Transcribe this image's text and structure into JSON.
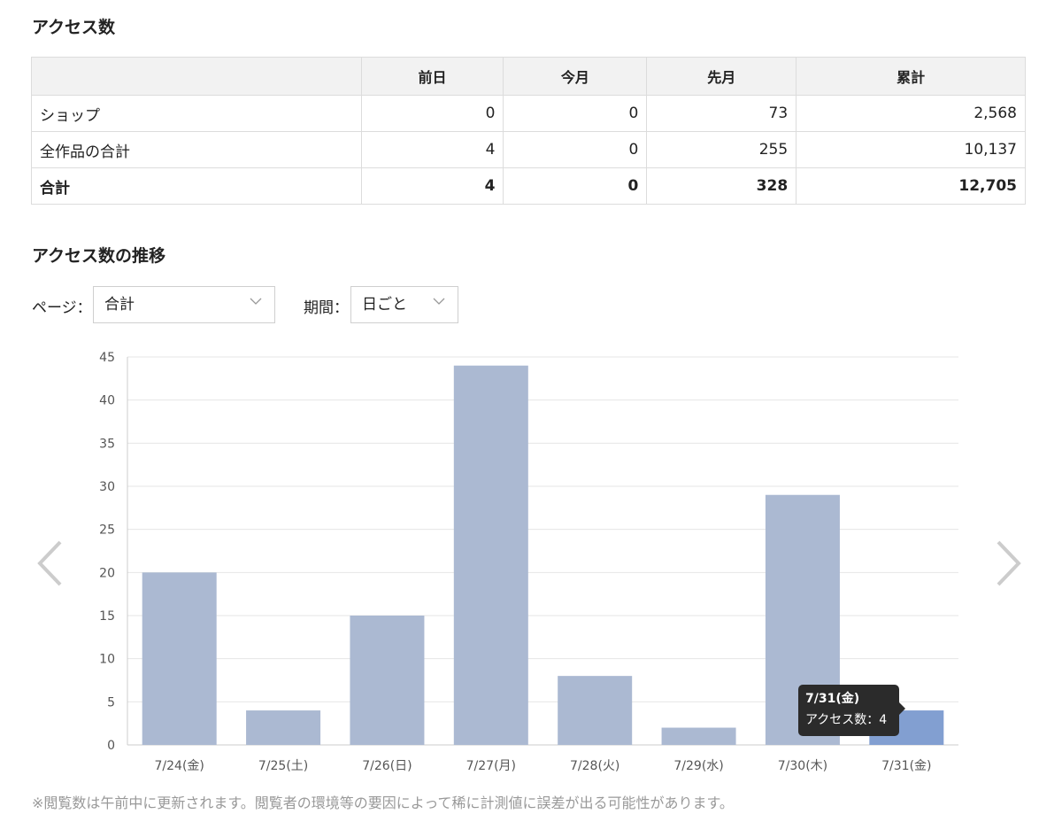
{
  "access_section": {
    "title": "アクセス数",
    "columns": [
      "",
      "前日",
      "今月",
      "先月",
      "累計"
    ],
    "rows": [
      {
        "name": "ショップ",
        "values": [
          "0",
          "0",
          "73",
          "2,568"
        ]
      },
      {
        "name": "全作品の合計",
        "values": [
          "4",
          "0",
          "255",
          "10,137"
        ]
      },
      {
        "name": "合計",
        "values": [
          "4",
          "0",
          "328",
          "12,705"
        ]
      }
    ]
  },
  "trend_section": {
    "title": "アクセス数の推移",
    "page_label": "ページ：",
    "page_value": "合計",
    "period_label": "期間：",
    "period_value": "日ごと"
  },
  "chart_data": {
    "type": "bar",
    "categories": [
      "7/24(金)",
      "7/25(土)",
      "7/26(日)",
      "7/27(月)",
      "7/28(火)",
      "7/29(水)",
      "7/30(木)",
      "7/31(金)"
    ],
    "values": [
      20,
      4,
      15,
      44,
      8,
      2,
      29,
      4
    ],
    "ylim": [
      0,
      45
    ],
    "yticks": [
      0,
      5,
      10,
      15,
      20,
      25,
      30,
      35,
      40,
      45
    ],
    "grid": true,
    "highlight_index": 7,
    "colors": {
      "bar": "#abb9d2",
      "highlight": "#829fd1",
      "grid": "#e6e6e6",
      "tick_text": "#555555"
    }
  },
  "tooltip": {
    "title": "7/31(金)",
    "body": "アクセス数：4"
  },
  "footnote": "※閲覧数は午前中に更新されます。閲覧者の環境等の要因によって稀に計測値に誤差が出る可能性があります。"
}
